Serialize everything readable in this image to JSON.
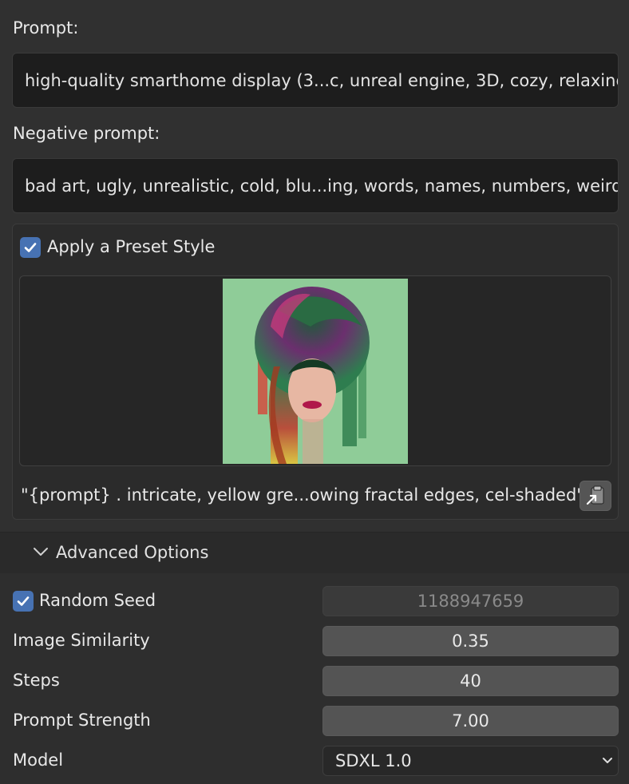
{
  "prompt": {
    "label": "Prompt:",
    "value": "high-quality smarthome display (3...c, unreal engine, 3D, cozy, relaxing"
  },
  "negative_prompt": {
    "label": "Negative prompt:",
    "value": "bad art, ugly, unrealistic, cold, blu...ing, words, names, numbers, weird"
  },
  "preset_style": {
    "checkbox_label": "Apply a Preset Style",
    "checked": true,
    "style_text": "\"{prompt} . intricate, yellow gre...owing fractal edges, cel-shaded\"",
    "paste_icon": "paste-clipboard-icon"
  },
  "advanced": {
    "header_label": "Advanced Options",
    "expanded": true,
    "random_seed": {
      "label": "Random Seed",
      "checked": true,
      "value": "1188947659"
    },
    "image_similarity": {
      "label": "Image Similarity",
      "value": "0.35"
    },
    "steps": {
      "label": "Steps",
      "value": "40"
    },
    "prompt_strength": {
      "label": "Prompt Strength",
      "value": "7.00"
    },
    "model": {
      "label": "Model",
      "value": "SDXL 1.0"
    }
  },
  "colors": {
    "accent": "#4772b3",
    "panel_bg": "#303030",
    "field_bg": "#1d1d1d",
    "slider_bg": "#545454"
  }
}
